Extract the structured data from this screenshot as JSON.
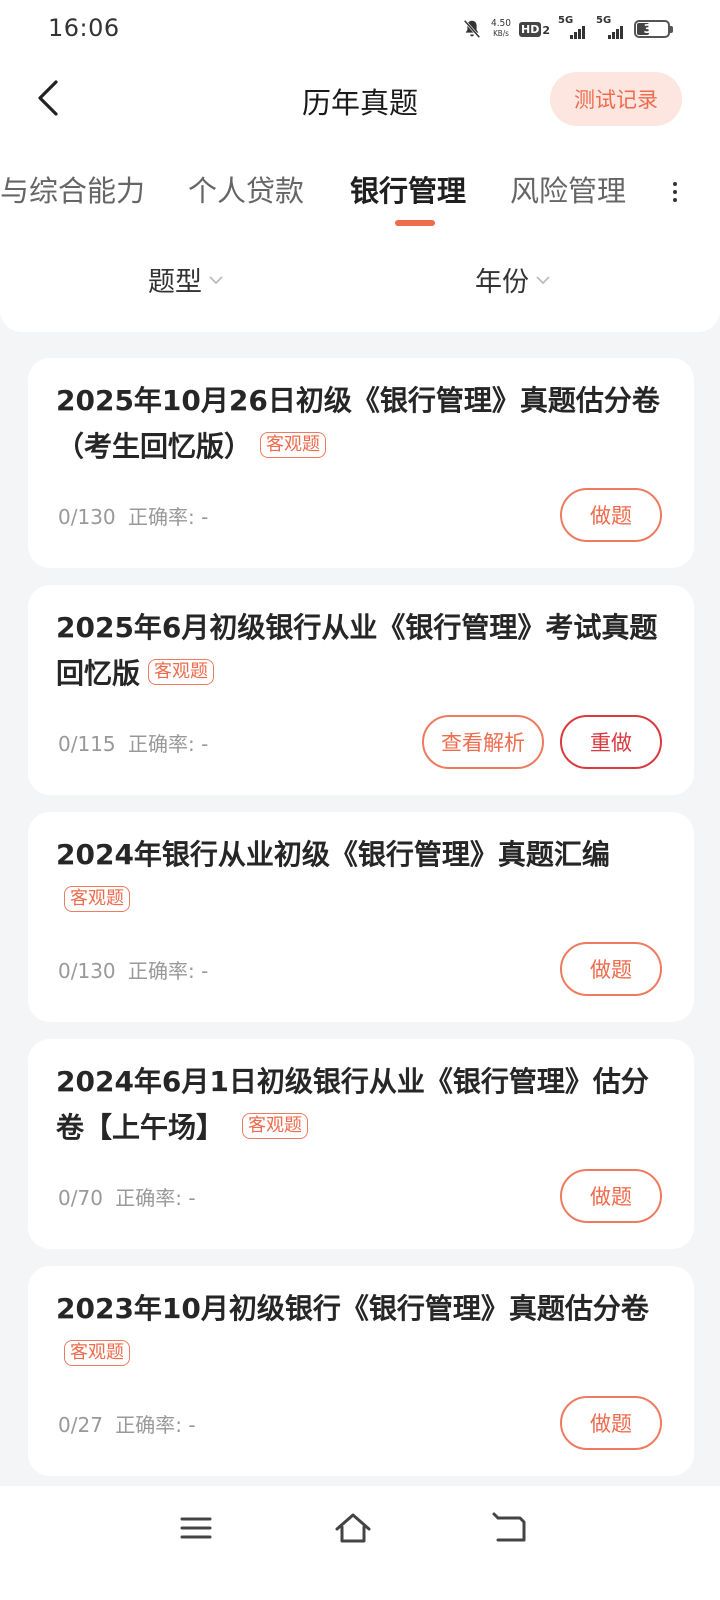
{
  "status_bar": {
    "time": "16:06",
    "net_speed_value": "4.50",
    "net_speed_unit": "KB/s",
    "hd_label": "HD",
    "hd_sub": "2",
    "signal1_label": "5G",
    "signal2_label": "5G",
    "battery_level": "39"
  },
  "header": {
    "title": "历年真题",
    "record_button": "测试记录"
  },
  "tabs": [
    {
      "label": "与综合能力",
      "active": false
    },
    {
      "label": "个人贷款",
      "active": false
    },
    {
      "label": "银行管理",
      "active": true
    },
    {
      "label": "风险管理",
      "active": false
    }
  ],
  "filters": {
    "type_label": "题型",
    "year_label": "年份"
  },
  "papers": [
    {
      "title": "2025年10月26日初级《银行管理》真题估分卷（考生回忆版）",
      "tag": "客观题",
      "progress": "0/130",
      "accuracy_label": "正确率:",
      "accuracy_value": "-",
      "primary_button": "做题"
    },
    {
      "title": "2025年6月初级银行从业《银行管理》考试真题回忆版",
      "tag": "客观题",
      "progress": "0/115",
      "accuracy_label": "正确率:",
      "accuracy_value": "-",
      "secondary_button": "查看解析",
      "primary_button": "重做"
    },
    {
      "title": "2024年银行从业初级《银行管理》真题汇编",
      "tag": "客观题",
      "progress": "0/130",
      "accuracy_label": "正确率:",
      "accuracy_value": "-",
      "primary_button": "做题"
    },
    {
      "title": "2024年6月1日初级银行从业《银行管理》估分卷【上午场】",
      "tag": "客观题",
      "progress": "0/70",
      "accuracy_label": "正确率:",
      "accuracy_value": "-",
      "primary_button": "做题"
    },
    {
      "title": "2023年10月初级银行《银行管理》真题估分卷",
      "tag": "客观题",
      "progress": "0/27",
      "accuracy_label": "正确率:",
      "accuracy_value": "-",
      "primary_button": "做题"
    }
  ],
  "colors": {
    "accent": "#ee6b4d",
    "accent_soft": "#fde6e0",
    "redo": "#d9393f",
    "background": "#f4f5f7"
  },
  "icons": {
    "back": "back-arrow-icon",
    "more": "more-dots-icon",
    "menu": "menu-icon",
    "home": "home-icon",
    "return": "return-icon",
    "mute": "bell-off-icon"
  }
}
